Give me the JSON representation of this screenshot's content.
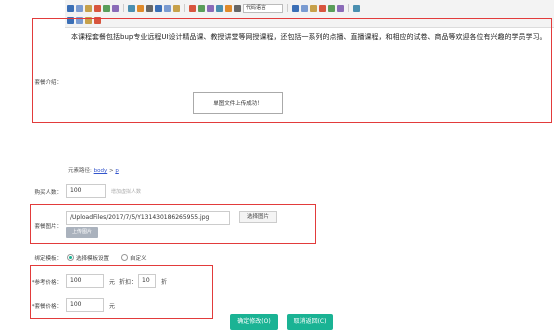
{
  "toolbar": {
    "font_select": "代码语言",
    "row1_icons": [
      "bold-icon",
      "align-left-icon",
      "align-center-icon",
      "align-right-icon",
      "align-justify-icon",
      "italic-icon",
      "underline-icon",
      "strikethrough-icon",
      "link-icon",
      "unlink-icon",
      "anchor-icon",
      "image-icon",
      "video-icon",
      "emotion-icon",
      "map-icon",
      "table-icon",
      "insert-row-icon",
      "attachment-icon",
      "template-icon",
      "code-icon",
      "horizontal-rule-icon",
      "date-icon",
      "time-icon",
      "special-char-icon",
      "spechars-icon"
    ],
    "row2_icons": [
      "print-icon",
      "preview-icon",
      "search-replace-icon",
      "help-icon"
    ]
  },
  "editor": {
    "content": "本课程套餐包括bup专业远程UI设计精品课、教授讲堂等网授课程，还包括一系列的点播、直播课程，和相应的试卷、商品等欢迎各位有兴趣的学员学习。",
    "toast": "单图文件上传成功！",
    "element_path_label": "元素路径:",
    "element_path_body": "body",
    "element_path_sep": ">",
    "element_path_p": "p"
  },
  "form": {
    "intro_label": "套餐介绍：",
    "buyers_label": "购买人数：",
    "buyers_value": "100",
    "buyers_hint": "增加虚拟人数",
    "image_label": "套餐图片：",
    "image_path": "/UploadFiles/2017/7/5/Y131430186265955.jpg",
    "choose_image": "选择图片",
    "upload_image": "上传图片",
    "template_label": "绑定模板：",
    "template_option1": "选择模板设置",
    "template_option2": "自定义",
    "ref_price_label": "*参考价格：",
    "ref_price_value": "100",
    "ref_price_unit": "元",
    "discount_label": "折扣：",
    "discount_value": "10",
    "discount_unit": "折",
    "set_price_label": "*套餐价格：",
    "set_price_value": "100",
    "set_price_unit": "元",
    "confirm_button": "确定修改(O)",
    "cancel_button": "取消返回(C)"
  },
  "colors": {
    "accent": "#1ab394",
    "highlight": "#e23b3b"
  }
}
